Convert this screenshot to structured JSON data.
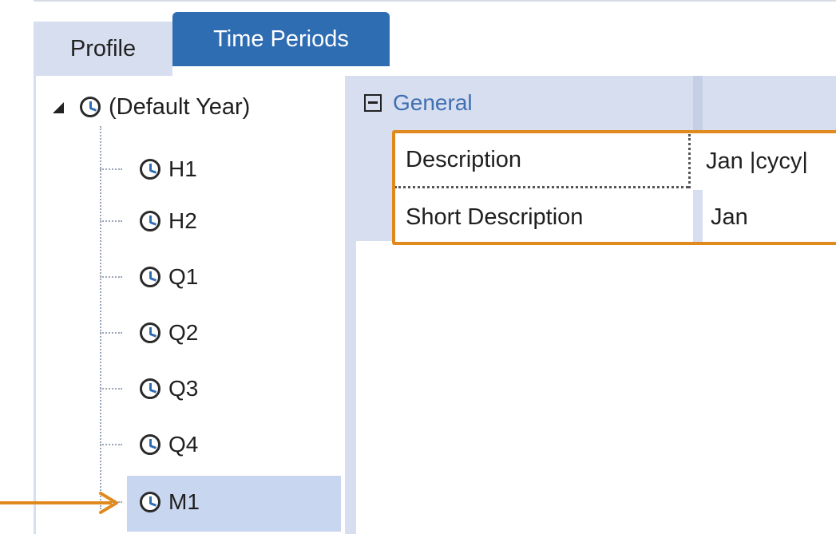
{
  "tabs": {
    "profile": "Profile",
    "time_periods": "Time Periods"
  },
  "tree": {
    "root_label": "(Default Year)",
    "items": [
      {
        "label": "H1"
      },
      {
        "label": "H2"
      },
      {
        "label": "Q1"
      },
      {
        "label": "Q2"
      },
      {
        "label": "Q3"
      },
      {
        "label": "Q4"
      },
      {
        "label": "M1"
      }
    ],
    "selected": "M1"
  },
  "properties": {
    "category": "General",
    "rows": [
      {
        "name": "Description",
        "value": "Jan |cycy|"
      },
      {
        "name": "Short Description",
        "value": "Jan"
      }
    ]
  },
  "colors": {
    "accent": "#2f6db3",
    "highlight_border": "#e08a1e",
    "selection": "#c9d6ef"
  },
  "icons": {
    "tree_item": "clock-icon",
    "category_toggle": "collapse-minus-icon",
    "annotation": "orange-arrow-icon"
  }
}
